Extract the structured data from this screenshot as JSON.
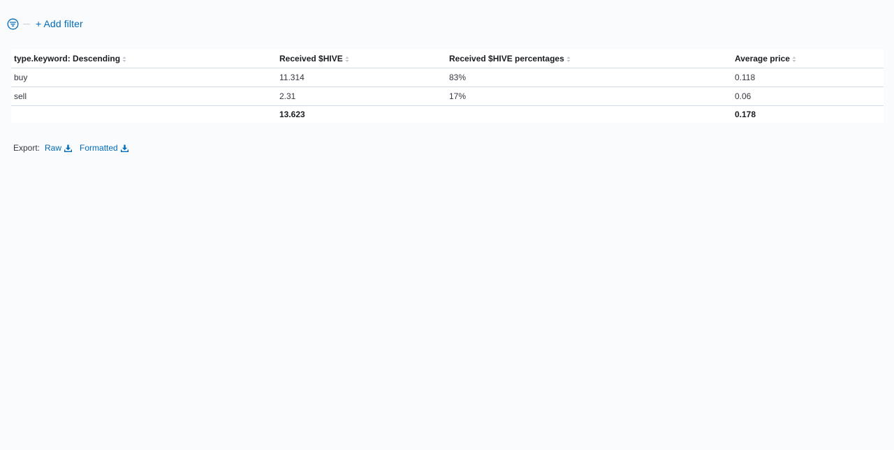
{
  "filter_bar": {
    "add_filter_label": "+ Add filter",
    "filter_icon": "filter-circle-icon"
  },
  "table": {
    "columns": [
      "type.keyword: Descending",
      "Received $HIVE",
      "Received $HIVE percentages",
      "Average price"
    ],
    "rows": [
      [
        "buy",
        "11.314",
        "83%",
        "0.118"
      ],
      [
        "sell",
        "2.31",
        "17%",
        "0.06"
      ]
    ],
    "totals": [
      "",
      "13.623",
      "",
      "0.178"
    ]
  },
  "export": {
    "label": "Export:",
    "raw_label": "Raw",
    "formatted_label": "Formatted",
    "icon": "download-icon"
  },
  "colors": {
    "link": "#006bb8",
    "background": "#fafbfd",
    "border": "#d3dae6"
  }
}
